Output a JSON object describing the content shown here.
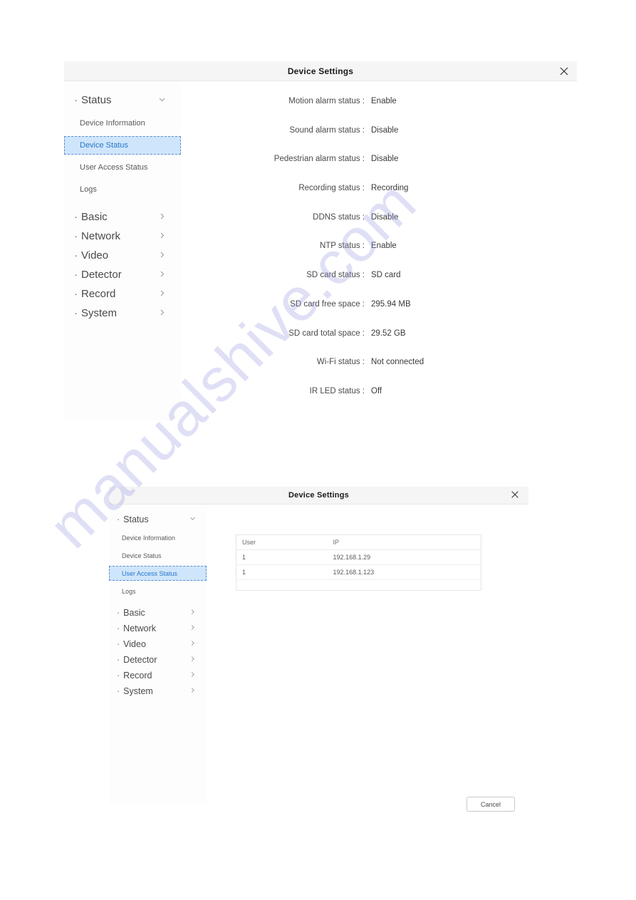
{
  "watermark": {
    "text": "manualshive.com"
  },
  "dialogs": [
    {
      "id": "device-status",
      "title": "Device Settings",
      "close_icon": "close-icon",
      "sidebar": {
        "groups": [
          {
            "label": "Status",
            "chevron": "chevron-down-icon",
            "expanded": true
          },
          {
            "label": "Basic",
            "chevron": "chevron-right-icon",
            "expanded": false
          },
          {
            "label": "Network",
            "chevron": "chevron-right-icon",
            "expanded": false
          },
          {
            "label": "Video",
            "chevron": "chevron-right-icon",
            "expanded": false
          },
          {
            "label": "Detector",
            "chevron": "chevron-right-icon",
            "expanded": false
          },
          {
            "label": "Record",
            "chevron": "chevron-right-icon",
            "expanded": false
          },
          {
            "label": "System",
            "chevron": "chevron-right-icon",
            "expanded": false
          }
        ],
        "sub_items": [
          {
            "label": "Device Information",
            "active": false
          },
          {
            "label": "Device Status",
            "active": true
          },
          {
            "label": "User Access Status",
            "active": false
          },
          {
            "label": "Logs",
            "active": false
          }
        ]
      },
      "status_rows": [
        {
          "label": "Motion alarm status :",
          "value": "Enable"
        },
        {
          "label": "Sound alarm status :",
          "value": "Disable"
        },
        {
          "label": "Pedestrian alarm status :",
          "value": "Disable"
        },
        {
          "label": "Recording status :",
          "value": "Recording"
        },
        {
          "label": "DDNS status :",
          "value": "Disable"
        },
        {
          "label": "NTP status :",
          "value": "Enable"
        },
        {
          "label": "SD card status :",
          "value": "SD card"
        },
        {
          "label": "SD card free space :",
          "value": "295.94 MB"
        },
        {
          "label": "SD card total space :",
          "value": "29.52 GB"
        },
        {
          "label": "Wi-Fi status :",
          "value": "Not connected"
        },
        {
          "label": "IR LED status :",
          "value": "Off"
        }
      ]
    },
    {
      "id": "user-access",
      "title": "Device Settings",
      "close_icon": "close-icon",
      "sidebar": {
        "groups": [
          {
            "label": "Status",
            "chevron": "chevron-down-icon",
            "expanded": true
          },
          {
            "label": "Basic",
            "chevron": "chevron-right-icon",
            "expanded": false
          },
          {
            "label": "Network",
            "chevron": "chevron-right-icon",
            "expanded": false
          },
          {
            "label": "Video",
            "chevron": "chevron-right-icon",
            "expanded": false
          },
          {
            "label": "Detector",
            "chevron": "chevron-right-icon",
            "expanded": false
          },
          {
            "label": "Record",
            "chevron": "chevron-right-icon",
            "expanded": false
          },
          {
            "label": "System",
            "chevron": "chevron-right-icon",
            "expanded": false
          }
        ],
        "sub_items": [
          {
            "label": "Device Information",
            "active": false
          },
          {
            "label": "Device Status",
            "active": false
          },
          {
            "label": "User Access Status",
            "active": true
          },
          {
            "label": "Logs",
            "active": false
          }
        ]
      },
      "table": {
        "columns": [
          "User",
          "IP"
        ],
        "rows": [
          [
            "1",
            "192.168.1.29"
          ],
          [
            "1",
            "192.168.1.123"
          ]
        ]
      },
      "cancel_label": "Cancel"
    }
  ],
  "colors": {
    "accent": "#2878c8",
    "active_bg": "#cfe5fb",
    "titlebar_bg": "#f5f5f5",
    "watermark": "#9696e1"
  }
}
